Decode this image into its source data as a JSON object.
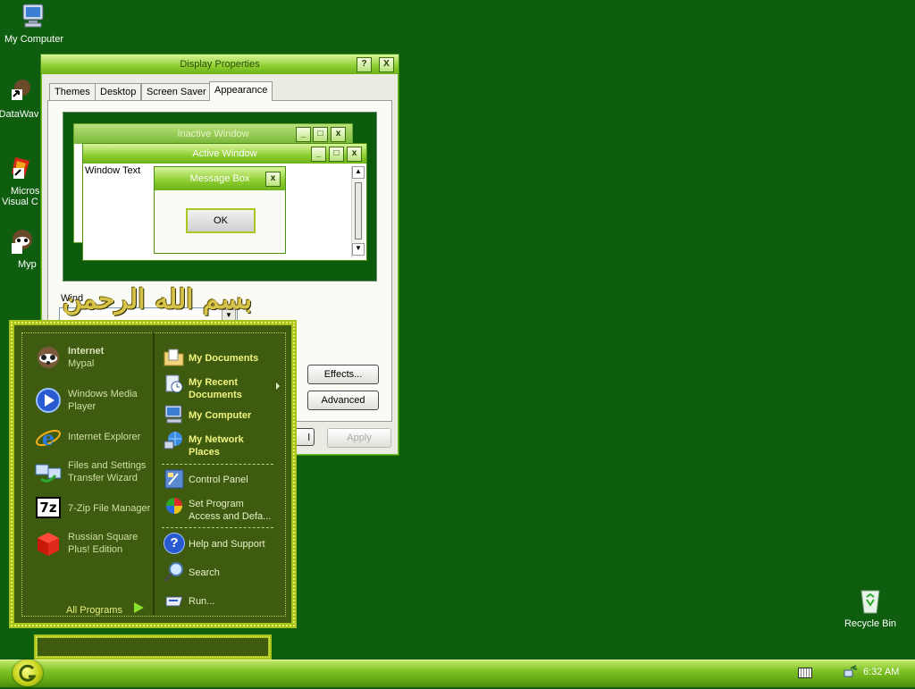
{
  "desktop": {
    "icons": [
      {
        "name": "my-computer",
        "label": "My Computer"
      },
      {
        "name": "datawave",
        "label": "DataWav"
      },
      {
        "name": "ms-visual",
        "label1": "Micros",
        "label2": "Visual C"
      },
      {
        "name": "mypal",
        "label": "Myp"
      },
      {
        "name": "recycle-bin",
        "label": "Recycle Bin"
      }
    ],
    "calligraphy": "بسم الله الرحمن الرحيم"
  },
  "display_properties": {
    "title": "Display Properties",
    "help_btn": "?",
    "close_btn": "X",
    "tabs": [
      "Themes",
      "Desktop",
      "Screen Saver",
      "Appearance"
    ],
    "preview": {
      "inactive_title": "Inactive Window",
      "active_title": "Active Window",
      "window_text": "Window Text",
      "msgbox_title": "Message Box",
      "ok": "OK"
    },
    "windows_and_buttons_label": "Wind",
    "effects_btn": "Effects...",
    "advanced_btn": "Advanced",
    "apply_btn": "Apply",
    "partial_btn": "l"
  },
  "start_menu": {
    "left": [
      {
        "title": "Internet",
        "sub": "Mypal"
      },
      {
        "title": "Windows Media",
        "sub": "Player"
      },
      {
        "title": "Internet Explorer",
        "sub": ""
      },
      {
        "title": "Files and Settings",
        "sub": "Transfer Wizard"
      },
      {
        "title": "7-Zip File Manager",
        "sub": ""
      },
      {
        "title": "Russian Square",
        "sub": "Plus! Edition"
      }
    ],
    "all_programs": "All Programs",
    "right_bold": [
      {
        "line1": "My Documents",
        "line2": ""
      },
      {
        "line1": "My Recent",
        "line2": "Documents"
      },
      {
        "line1": "My Computer",
        "line2": ""
      },
      {
        "line1": "My Network",
        "line2": "Places"
      }
    ],
    "right_normal": [
      {
        "line1": "Control Panel",
        "line2": ""
      },
      {
        "line1": "Set Program",
        "line2": "Access and Defa..."
      },
      {
        "line1": "Help and Support",
        "line2": ""
      },
      {
        "line1": "Search",
        "line2": ""
      },
      {
        "line1": "Run...",
        "line2": ""
      }
    ]
  },
  "taskbar": {
    "clock": "6:32 AM"
  },
  "colors": {
    "desktop": "#0f5e0f",
    "accent": "#8ccd2f",
    "start_menu_bg": "#3f5b10"
  }
}
